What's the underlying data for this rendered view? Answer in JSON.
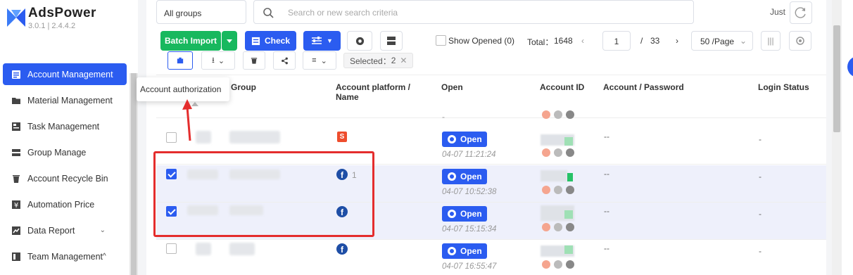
{
  "app": {
    "name": "AdsPower",
    "version": "3.0.1  |  2.4.4.2"
  },
  "sidebar": {
    "items": [
      {
        "label": "Account Management",
        "icon": "account-icon",
        "active": true
      },
      {
        "label": "Material Management",
        "icon": "folder-icon"
      },
      {
        "label": "Task Management",
        "icon": "task-icon"
      },
      {
        "label": "Group Manage",
        "icon": "group-icon"
      },
      {
        "label": "Account Recycle Bin",
        "icon": "trash-icon"
      },
      {
        "label": "Automation Price",
        "icon": "price-icon"
      },
      {
        "label": "Data Report",
        "icon": "chart-icon",
        "chevron": "⌄"
      },
      {
        "label": "Team Management",
        "icon": "team-icon",
        "chevron": "^"
      }
    ]
  },
  "filter": {
    "group": "All groups",
    "search_placeholder": "Search or new search criteria",
    "just": "Just"
  },
  "toolbar": {
    "batch_import": "Batch Import",
    "check": "Check",
    "show_opened": "Show Opened (0)",
    "total_label": "Total：",
    "total": "1648",
    "page": "1",
    "page_sep": "/",
    "pages": "33",
    "per_page": "50 /Page",
    "selected_label": "Selected：",
    "selected": "2"
  },
  "tooltip": "Account authorization",
  "table": {
    "headers": {
      "group": "Group",
      "platform": "Account platform /",
      "platform2": "Name",
      "open": "Open",
      "account_id": "Account ID",
      "account_password": "Account / Password",
      "login_status": "Login Status"
    },
    "header_row_time": "-",
    "rows": [
      {
        "platform": "shopee",
        "count": "",
        "open": "Open",
        "time": "04-07 11:21:24",
        "account": "--",
        "login": "-",
        "selected": false
      },
      {
        "platform": "facebook",
        "count": "1",
        "open": "Open",
        "time": "04-07 10:52:38",
        "account": "--",
        "login": "-",
        "selected": true
      },
      {
        "platform": "facebook",
        "count": "",
        "open": "Open",
        "time": "04-07 15:15:34",
        "account": "--",
        "login": "-",
        "selected": true
      },
      {
        "platform": "facebook",
        "count": "",
        "open": "Open",
        "time": "04-07 16:55:47",
        "account": "--",
        "login": "-",
        "selected": false
      }
    ]
  },
  "colors": {
    "primary": "#2b5cf0",
    "green": "#18b85e",
    "red": "#e42d2d",
    "selected_row": "#eef0fb"
  }
}
